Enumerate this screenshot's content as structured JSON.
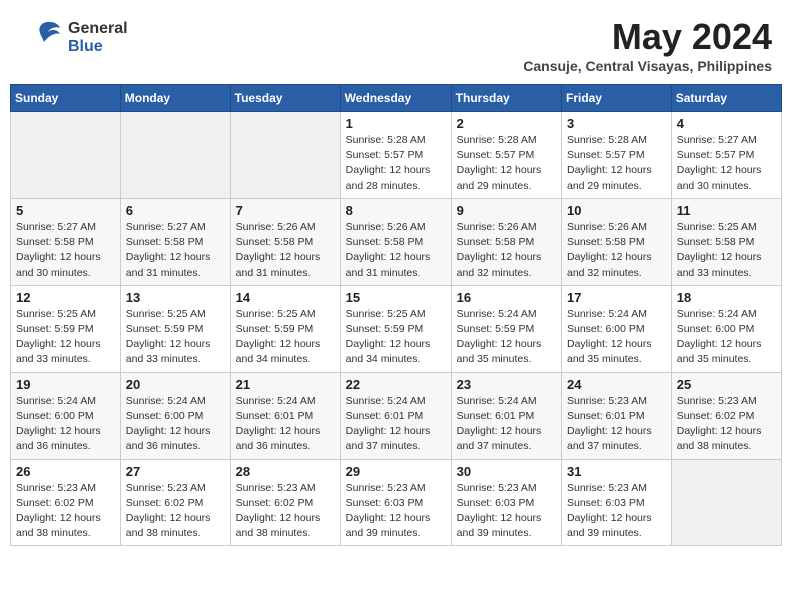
{
  "header": {
    "logo_general": "General",
    "logo_blue": "Blue",
    "month_year": "May 2024",
    "location": "Cansuje, Central Visayas, Philippines"
  },
  "weekdays": [
    "Sunday",
    "Monday",
    "Tuesday",
    "Wednesday",
    "Thursday",
    "Friday",
    "Saturday"
  ],
  "weeks": [
    [
      {
        "day": "",
        "info": ""
      },
      {
        "day": "",
        "info": ""
      },
      {
        "day": "",
        "info": ""
      },
      {
        "day": "1",
        "info": "Sunrise: 5:28 AM\nSunset: 5:57 PM\nDaylight: 12 hours\nand 28 minutes."
      },
      {
        "day": "2",
        "info": "Sunrise: 5:28 AM\nSunset: 5:57 PM\nDaylight: 12 hours\nand 29 minutes."
      },
      {
        "day": "3",
        "info": "Sunrise: 5:28 AM\nSunset: 5:57 PM\nDaylight: 12 hours\nand 29 minutes."
      },
      {
        "day": "4",
        "info": "Sunrise: 5:27 AM\nSunset: 5:57 PM\nDaylight: 12 hours\nand 30 minutes."
      }
    ],
    [
      {
        "day": "5",
        "info": "Sunrise: 5:27 AM\nSunset: 5:58 PM\nDaylight: 12 hours\nand 30 minutes."
      },
      {
        "day": "6",
        "info": "Sunrise: 5:27 AM\nSunset: 5:58 PM\nDaylight: 12 hours\nand 31 minutes."
      },
      {
        "day": "7",
        "info": "Sunrise: 5:26 AM\nSunset: 5:58 PM\nDaylight: 12 hours\nand 31 minutes."
      },
      {
        "day": "8",
        "info": "Sunrise: 5:26 AM\nSunset: 5:58 PM\nDaylight: 12 hours\nand 31 minutes."
      },
      {
        "day": "9",
        "info": "Sunrise: 5:26 AM\nSunset: 5:58 PM\nDaylight: 12 hours\nand 32 minutes."
      },
      {
        "day": "10",
        "info": "Sunrise: 5:26 AM\nSunset: 5:58 PM\nDaylight: 12 hours\nand 32 minutes."
      },
      {
        "day": "11",
        "info": "Sunrise: 5:25 AM\nSunset: 5:58 PM\nDaylight: 12 hours\nand 33 minutes."
      }
    ],
    [
      {
        "day": "12",
        "info": "Sunrise: 5:25 AM\nSunset: 5:59 PM\nDaylight: 12 hours\nand 33 minutes."
      },
      {
        "day": "13",
        "info": "Sunrise: 5:25 AM\nSunset: 5:59 PM\nDaylight: 12 hours\nand 33 minutes."
      },
      {
        "day": "14",
        "info": "Sunrise: 5:25 AM\nSunset: 5:59 PM\nDaylight: 12 hours\nand 34 minutes."
      },
      {
        "day": "15",
        "info": "Sunrise: 5:25 AM\nSunset: 5:59 PM\nDaylight: 12 hours\nand 34 minutes."
      },
      {
        "day": "16",
        "info": "Sunrise: 5:24 AM\nSunset: 5:59 PM\nDaylight: 12 hours\nand 35 minutes."
      },
      {
        "day": "17",
        "info": "Sunrise: 5:24 AM\nSunset: 6:00 PM\nDaylight: 12 hours\nand 35 minutes."
      },
      {
        "day": "18",
        "info": "Sunrise: 5:24 AM\nSunset: 6:00 PM\nDaylight: 12 hours\nand 35 minutes."
      }
    ],
    [
      {
        "day": "19",
        "info": "Sunrise: 5:24 AM\nSunset: 6:00 PM\nDaylight: 12 hours\nand 36 minutes."
      },
      {
        "day": "20",
        "info": "Sunrise: 5:24 AM\nSunset: 6:00 PM\nDaylight: 12 hours\nand 36 minutes."
      },
      {
        "day": "21",
        "info": "Sunrise: 5:24 AM\nSunset: 6:01 PM\nDaylight: 12 hours\nand 36 minutes."
      },
      {
        "day": "22",
        "info": "Sunrise: 5:24 AM\nSunset: 6:01 PM\nDaylight: 12 hours\nand 37 minutes."
      },
      {
        "day": "23",
        "info": "Sunrise: 5:24 AM\nSunset: 6:01 PM\nDaylight: 12 hours\nand 37 minutes."
      },
      {
        "day": "24",
        "info": "Sunrise: 5:23 AM\nSunset: 6:01 PM\nDaylight: 12 hours\nand 37 minutes."
      },
      {
        "day": "25",
        "info": "Sunrise: 5:23 AM\nSunset: 6:02 PM\nDaylight: 12 hours\nand 38 minutes."
      }
    ],
    [
      {
        "day": "26",
        "info": "Sunrise: 5:23 AM\nSunset: 6:02 PM\nDaylight: 12 hours\nand 38 minutes."
      },
      {
        "day": "27",
        "info": "Sunrise: 5:23 AM\nSunset: 6:02 PM\nDaylight: 12 hours\nand 38 minutes."
      },
      {
        "day": "28",
        "info": "Sunrise: 5:23 AM\nSunset: 6:02 PM\nDaylight: 12 hours\nand 38 minutes."
      },
      {
        "day": "29",
        "info": "Sunrise: 5:23 AM\nSunset: 6:03 PM\nDaylight: 12 hours\nand 39 minutes."
      },
      {
        "day": "30",
        "info": "Sunrise: 5:23 AM\nSunset: 6:03 PM\nDaylight: 12 hours\nand 39 minutes."
      },
      {
        "day": "31",
        "info": "Sunrise: 5:23 AM\nSunset: 6:03 PM\nDaylight: 12 hours\nand 39 minutes."
      },
      {
        "day": "",
        "info": ""
      }
    ]
  ]
}
